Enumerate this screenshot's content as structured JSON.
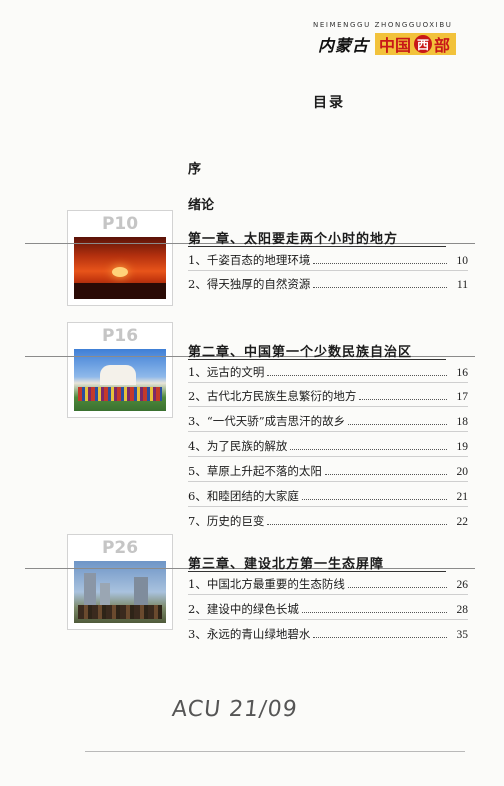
{
  "header": {
    "pinyin": "NEIMENGGU ZHONGGUOXIBU",
    "brand_left": "内蒙古",
    "brand_zhongguo": "中国",
    "brand_xi": "西",
    "brand_bu": "部"
  },
  "toc_title": "目录",
  "front_matter": [
    "序",
    "绪论"
  ],
  "chapters": [
    {
      "label": "P10",
      "title": "第一章、太阳要走两个小时的地方",
      "entries": [
        {
          "text": "1、千姿百态的地理环境",
          "page": "10"
        },
        {
          "text": "2、得天独厚的自然资源",
          "page": "11"
        }
      ]
    },
    {
      "label": "P16",
      "title": "第二章、中国第一个少数民族自治区",
      "entries": [
        {
          "text": "1、远古的文明",
          "page": "16"
        },
        {
          "text": "2、古代北方民族生息繁衍的地方",
          "page": "17"
        },
        {
          "text": "3、“一代天骄”成吉思汗的故乡",
          "page": "18"
        },
        {
          "text": "4、为了民族的解放",
          "page": "19"
        },
        {
          "text": "5、草原上升起不落的太阳",
          "page": "20"
        },
        {
          "text": "6、和睦团结的大家庭",
          "page": "21"
        },
        {
          "text": "7、历史的巨变",
          "page": "22"
        }
      ]
    },
    {
      "label": "P26",
      "title": "第三章、建设北方第一生态屏障",
      "entries": [
        {
          "text": "1、中国北方最重要的生态防线",
          "page": "26"
        },
        {
          "text": "2、建设中的绿色长城",
          "page": "28"
        },
        {
          "text": "3、永远的青山绿地碧水",
          "page": "35"
        }
      ]
    }
  ],
  "handwritten_note": "ACU 21/09"
}
